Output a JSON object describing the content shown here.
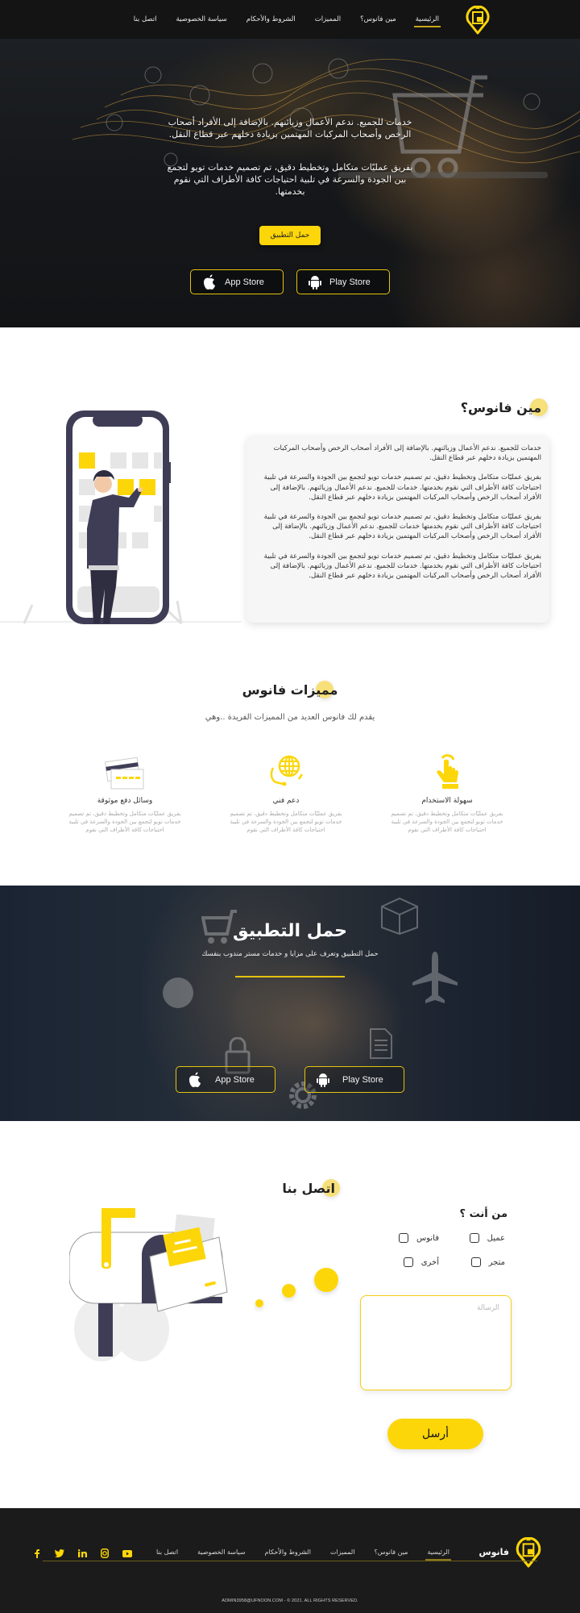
{
  "nav": {
    "items": [
      {
        "label": "الرئيسية",
        "active": true
      },
      {
        "label": "مين فانوس؟",
        "active": false
      },
      {
        "label": "المميزات",
        "active": false
      },
      {
        "label": "الشروط والأحكام",
        "active": false
      },
      {
        "label": "سياسة الخصوصية",
        "active": false
      },
      {
        "label": "اتصل بنا",
        "active": false
      }
    ],
    "logo_icon": "fanoos-logo-icon"
  },
  "hero": {
    "paragraph_1": "خدمات للجميع. ندعم الأعمال وزبائنهم. بالإضافة إلى الأفراد أصحاب الرخص وأصحاب المركبات المهتمين بزيادة دخلهم عبر قطاع النقل.",
    "paragraph_2": "بفريق عمليّات متكامل وتخطيط دقيق، تم تصميم خدمات تويو لتجمع بين الجودة والسرعة في تلبية احتياجات كافة الأطراف التي نقوم بخدمتها.",
    "download_button": "حمل التطبيق",
    "app_store": "App Store",
    "play_store": "Play Store"
  },
  "about": {
    "title": "مين فانوس؟",
    "paragraphs": [
      "خدمات للجميع. ندعم الأعمال وزبائنهم. بالإضافة إلى الأفراد أصحاب الرخص وأصحاب المركبات المهتمين بزيادة دخلهم عبر قطاع النقل.",
      "بفريق عمليّات متكامل وتخطيط دقيق، تم تصميم خدمات تويو لتجمع بين الجودة والسرعة في تلبية احتياجات كافة الأطراف التي نقوم بخدمتها. خدمات للجميع. ندعم الأعمال وزبائنهم. بالإضافة إلى الأفراد أصحاب الرخص وأصحاب المركبات المهتمين بزيادة دخلهم عبر قطاع النقل.",
      "بفريق عمليّات متكامل وتخطيط دقيق، تم تصميم خدمات تويو لتجمع بين الجودة والسرعة في تلبية احتياجات كافة الأطراف التي نقوم بخدمتها خدمات للجميع. ندعم الأعمال وزبائنهم. بالإضافة إلى الأفراد أصحاب الرخص وأصحاب المركبات المهتمين بزيادة دخلهم عبر قطاع النقل.",
      "بفريق عمليّات متكامل وتخطيط دقيق، تم تصميم خدمات تويو لتجمع بين الجودة والسرعة في تلبية احتياجات كافة الأطراف التي نقوم بخدمتها. خدمات للجميع. ندعم الأعمال وزبائنهم. بالإضافة إلى الأفراد أصحاب الرخص وأصحاب المركبات المهتمين بزيادة دخلهم عبر قطاع النقل."
    ]
  },
  "features": {
    "title": "مميزات فانوس",
    "subtitle": "يقدم لك فانوس العديد من المميزات الفريدة ..وهي",
    "items": [
      {
        "icon": "tap-hand-icon",
        "title": "سهولة الاستخدام",
        "desc": "بفريق عمليّات متكامل وتخطيط دقيق، تم تصميم خدمات تويو لتجمع بين الجودة والسرعة في تلبية احتياجات كافة الأطراف التي نقوم"
      },
      {
        "icon": "support-headset-icon",
        "title": "دعم فني",
        "desc": "بفريق عمليّات متكامل وتخطيط دقيق، تم تصميم خدمات تويو لتجمع بين الجودة والسرعة في تلبية احتياجات كافة الأطراف التي نقوم"
      },
      {
        "icon": "credit-cards-icon",
        "title": "وسائل دفع موثوقة",
        "desc": "بفريق عمليّات متكامل وتخطيط دقيق، تم تصميم خدمات تويو لتجمع بين الجودة والسرعة في تلبية احتياجات كافة الأطراف التي نقوم"
      }
    ]
  },
  "app_section": {
    "title": "حمل التطبيق",
    "subtitle": "حمل التطبيق وتعرف على مزايا و خدمات مستر مندوب بنفسك",
    "app_store": "App Store",
    "play_store": "Play Store"
  },
  "contact": {
    "title": "اتصل بنا",
    "who_label": "من أنت ؟",
    "options": [
      {
        "label": "عميل",
        "checked": false
      },
      {
        "label": "فانوس",
        "checked": false
      },
      {
        "label": "متجر",
        "checked": false
      },
      {
        "label": "أخرى",
        "checked": false
      }
    ],
    "message_placeholder": "الرسالة",
    "message_value": "",
    "send_button": "أرسل"
  },
  "footer": {
    "brand": "فانوس",
    "links": [
      {
        "label": "الرئيسية",
        "active": true
      },
      {
        "label": "مين فانوس؟",
        "active": false
      },
      {
        "label": "المميزات",
        "active": false
      },
      {
        "label": "الشروط والأحكام",
        "active": false
      },
      {
        "label": "سياسة الخصوصية",
        "active": false
      },
      {
        "label": "اتصل بنا",
        "active": false
      }
    ],
    "social": [
      "youtube-icon",
      "instagram-icon",
      "linkedin-icon",
      "twitter-icon",
      "facebook-icon"
    ],
    "copyright": "ADMIN3958@UFNOON.COM - © 2021. ALL RIGHTS RESERVED."
  },
  "colors": {
    "accent": "#fcd609",
    "dark": "#141414",
    "illustration_dark": "#3f3d56"
  }
}
